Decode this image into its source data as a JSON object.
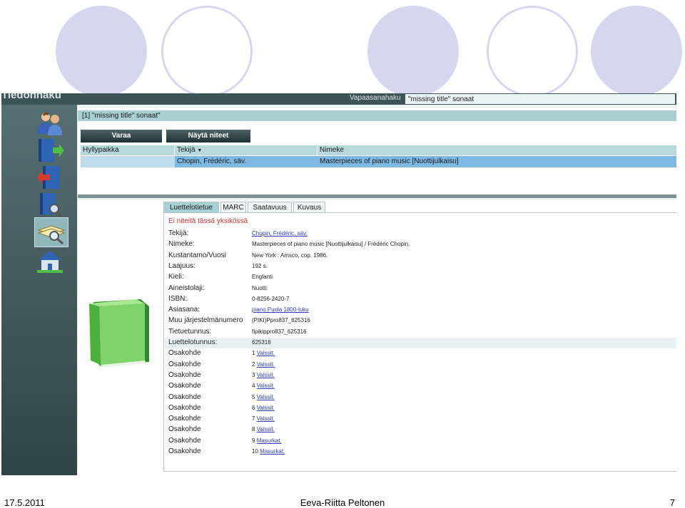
{
  "app": {
    "title": "Tiedonhaku"
  },
  "search": {
    "label": "Vapaasanahaku",
    "value": "\"missing title\" sonaat"
  },
  "results": {
    "query": "[1] \"missing title\" sonaat\"",
    "buttons": {
      "reserve": "Varaa",
      "show_items": "Näytä niteet"
    },
    "columns": {
      "shelf": "Hyllypaikka",
      "author": "Tekijä",
      "title": "Nimeke"
    },
    "sort_indicator": "▼",
    "row": {
      "shelf": "",
      "author": "Chopin, Frédéric, säv.",
      "title": "Masterpieces of piano music [Nuottijulkaisu]"
    }
  },
  "tabs": [
    "Luettelotietue",
    "MARC",
    "Saatavuus",
    "Kuvaus"
  ],
  "record": {
    "notice": "Ei niteitä tässä yksikössä",
    "fields": [
      {
        "label": "Tekijä:",
        "value": "Chopin, Frédéric, säv.",
        "link": true
      },
      {
        "label": "Nimeke:",
        "value": "Masterpieces of piano music [Nuottijulkaisu] / Frédéric Chopin."
      },
      {
        "label": "Kustantamo/Vuosi",
        "value": "New York : Amsco, cop. 1986."
      },
      {
        "label": "Laajuus:",
        "value": "192 s."
      },
      {
        "label": "Kieli:",
        "value": "Englanti"
      },
      {
        "label": "Aineistolaji:",
        "value": "Nuotti"
      },
      {
        "label": "ISBN:",
        "value": "0-8256-2420-7"
      },
      {
        "label": "Asiasana:",
        "value": "piano Puola 1800-luku",
        "link": true
      },
      {
        "label": "Muu järjestelmänumero",
        "value": "(PIKI)Ppro837_625316"
      },
      {
        "label": "Tietuetunnus:",
        "value": "fipikippro837_625316"
      },
      {
        "label": "Luettelotunnus:",
        "value": "625316",
        "highlight": true
      }
    ],
    "parts_label": "Osakohde",
    "parts": [
      {
        "num": "1",
        "title": "Valssit."
      },
      {
        "num": "2",
        "title": "Valssit."
      },
      {
        "num": "3",
        "title": "Valssit."
      },
      {
        "num": "4",
        "title": "Valssit."
      },
      {
        "num": "5",
        "title": "Valssit."
      },
      {
        "num": "6",
        "title": "Valssit."
      },
      {
        "num": "7",
        "title": "Valssit."
      },
      {
        "num": "8",
        "title": "Valssit."
      },
      {
        "num": "9",
        "title": "Masurkat."
      },
      {
        "num": "10",
        "title": "Masurkat."
      }
    ]
  },
  "footer": {
    "date": "17.5.2011",
    "author": "Eeva-Riitta Peltonen",
    "page": "7"
  },
  "colors": {
    "accent": "#a7d1d6",
    "selected_row": "#7cb8e2",
    "link": "#2b3fb8",
    "notice": "#d33030",
    "sidebar": "#3d5457"
  },
  "icons": [
    "users-icon",
    "book-forward-icon",
    "book-back-icon",
    "book-search-icon",
    "cards-search-icon",
    "home-icon",
    "green-book-icon"
  ]
}
